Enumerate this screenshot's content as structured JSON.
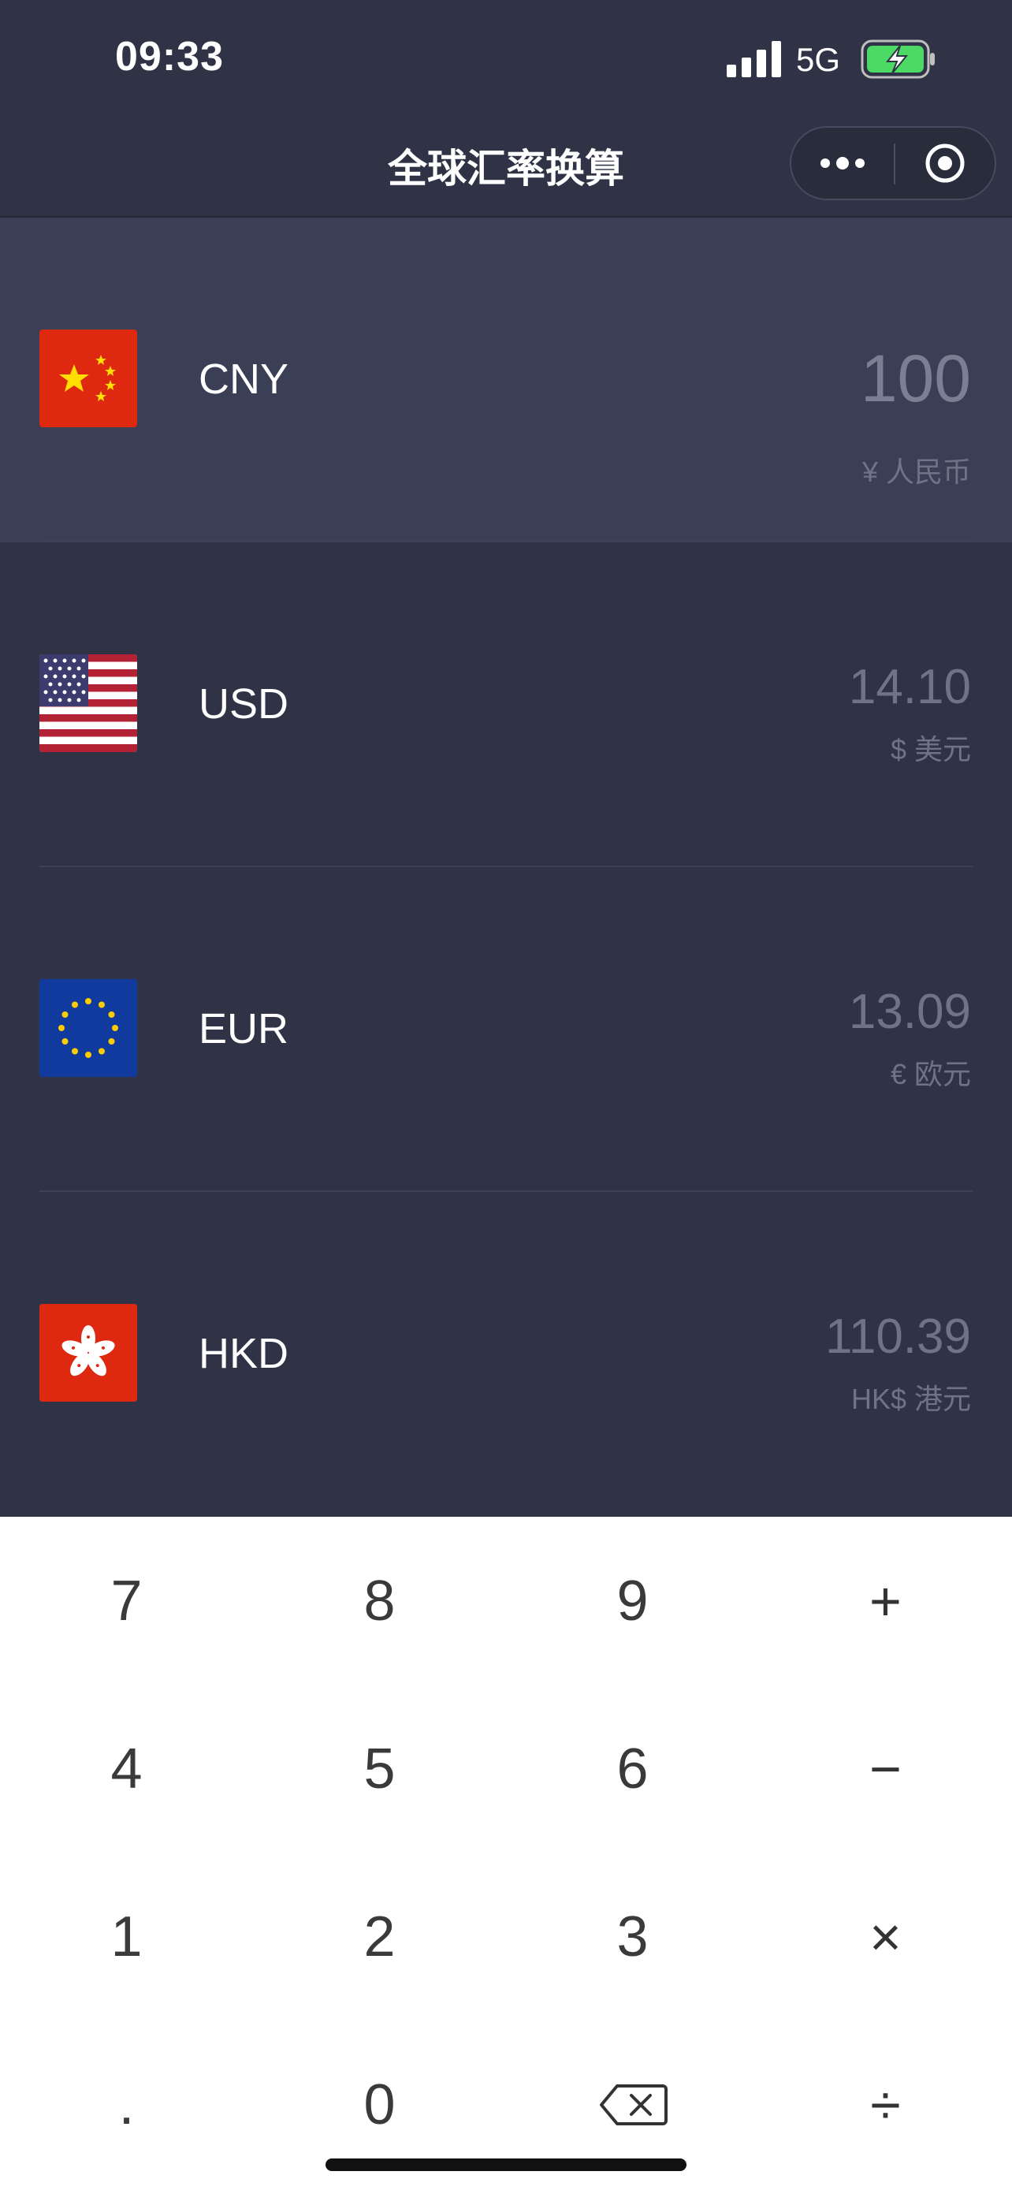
{
  "status_bar": {
    "time": "09:33",
    "network": "5G",
    "icons": [
      "signal-bars-icon",
      "battery-charging-icon"
    ]
  },
  "nav": {
    "title": "全球汇率换算",
    "more_icon": "more-dots-icon",
    "target_icon": "target-circle-icon"
  },
  "currencies": [
    {
      "code": "CNY",
      "amount": "100",
      "name": "¥ 人民币",
      "flag_icon": "china-flag-icon",
      "active": true
    },
    {
      "code": "USD",
      "amount": "14.10",
      "name": "$ 美元",
      "flag_icon": "usa-flag-icon",
      "active": false
    },
    {
      "code": "EUR",
      "amount": "13.09",
      "name": "€ 欧元",
      "flag_icon": "eu-flag-icon",
      "active": false
    },
    {
      "code": "HKD",
      "amount": "110.39",
      "name": "HK$ 港元",
      "flag_icon": "hong-kong-flag-icon",
      "active": false
    }
  ],
  "keypad": {
    "keys": [
      "7",
      "8",
      "9",
      "+",
      "4",
      "5",
      "6",
      "−",
      "1",
      "2",
      "3",
      "×",
      ".",
      "0",
      "backspace",
      "÷"
    ]
  },
  "colors": {
    "background": "#2f3345",
    "active_row": "#3a3f56",
    "keypad_bg": "#ffffff"
  }
}
